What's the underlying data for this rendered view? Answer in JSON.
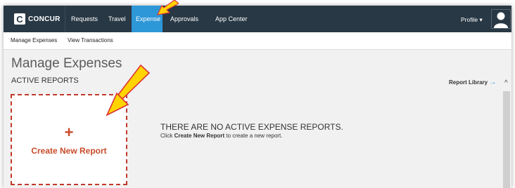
{
  "brand": {
    "logo_letter": "C",
    "logo_text": "CONCUR"
  },
  "nav": {
    "items": [
      {
        "label": "Requests"
      },
      {
        "label": "Travel"
      },
      {
        "label": "Expense",
        "active": true
      },
      {
        "label": "Approvals"
      },
      {
        "label": "App Center"
      }
    ],
    "profile_label": "Profile",
    "profile_caret": "▾"
  },
  "subnav": {
    "items": [
      {
        "label": "Manage Expenses"
      },
      {
        "label": "View Transactions"
      }
    ]
  },
  "page": {
    "title": "Manage Expenses",
    "section": "ACTIVE REPORTS",
    "report_library": "Report Library",
    "report_library_arrow": "→",
    "scroll_up": "^"
  },
  "create_card": {
    "plus": "+",
    "label": "Create New Report"
  },
  "empty_state": {
    "title": "THERE ARE NO ACTIVE EXPENSE REPORTS.",
    "sub_prefix": "Click ",
    "sub_bold": "Create New Report",
    "sub_suffix": " to create a new report."
  },
  "colors": {
    "topbar": "#283844",
    "active_tab": "#2e97d8",
    "accent_red": "#c94a2a",
    "highlight_arrow": "#ffd400"
  },
  "icons": {
    "avatar": "user-avatar-icon",
    "highlight": "yellow-arrow-icon"
  }
}
